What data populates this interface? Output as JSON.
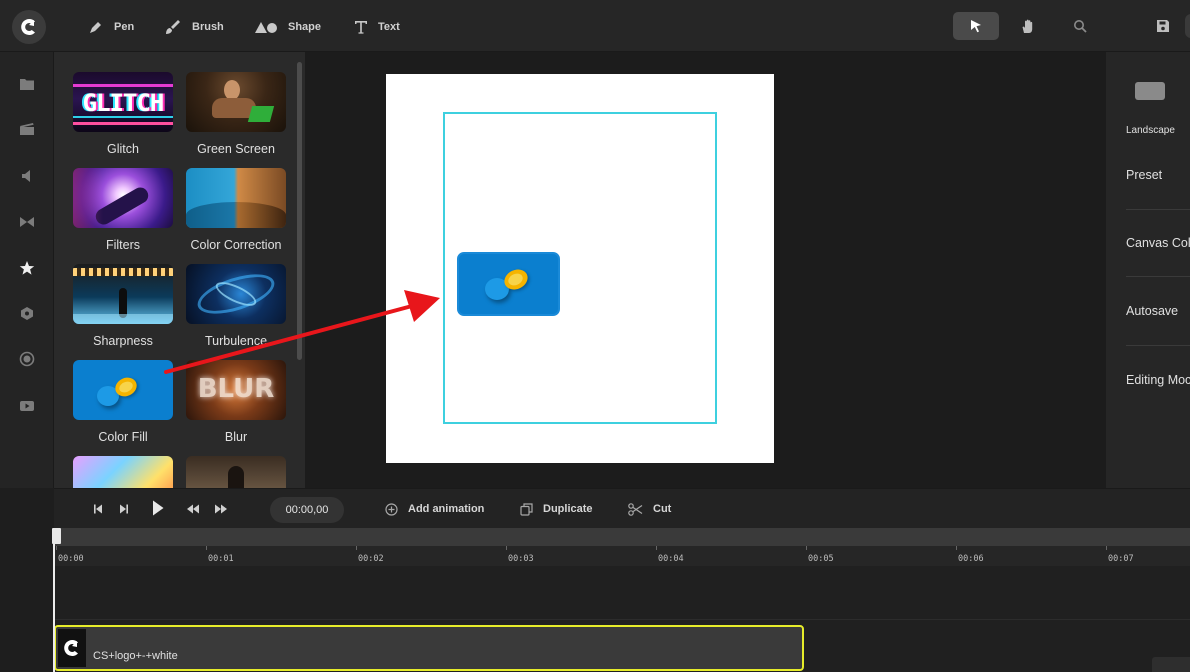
{
  "toolbar": {
    "tools": [
      {
        "label": "Pen",
        "icon": "pen-icon"
      },
      {
        "label": "Brush",
        "icon": "brush-icon"
      },
      {
        "label": "Shape",
        "icon": "shape-icon"
      },
      {
        "label": "Text",
        "icon": "text-icon"
      }
    ],
    "right_icons": [
      "select-arrow-icon",
      "hand-icon",
      "search-icon",
      "save-icon"
    ]
  },
  "rail": {
    "icons": [
      "folder-icon",
      "media-icon",
      "audio-icon",
      "transitions-icon",
      "effects-star-icon",
      "elements-icon",
      "record-icon",
      "video-icon"
    ],
    "active": "effects-star-icon"
  },
  "effects": [
    {
      "label": "Glitch"
    },
    {
      "label": "Green Screen"
    },
    {
      "label": "Filters"
    },
    {
      "label": "Color Correction"
    },
    {
      "label": "Sharpness"
    },
    {
      "label": "Turbulence"
    },
    {
      "label": "Color Fill"
    },
    {
      "label": "Blur"
    }
  ],
  "thumb_text": {
    "glitch": "GLITCH",
    "blur": "BLUR"
  },
  "right_panel": {
    "orientation": "Landscape",
    "preset": "Preset",
    "canvas_color": "Canvas Col",
    "autosave": "Autosave",
    "editing_mode": "Editing Moc"
  },
  "timeline_controls": {
    "timecode": "00:00,00",
    "add_animation": "Add animation",
    "duplicate": "Duplicate",
    "cut": "Cut"
  },
  "ruler_labels": [
    "00:00",
    "00:01",
    "00:02",
    "00:03",
    "00:04",
    "00:05",
    "00:06",
    "00:07"
  ],
  "clip": {
    "label": "CS+logo+-+white"
  },
  "colors": {
    "accent_cyan": "#3ed0df",
    "clip_outline": "#e6ec2a",
    "arrow_red": "#e8161b"
  }
}
